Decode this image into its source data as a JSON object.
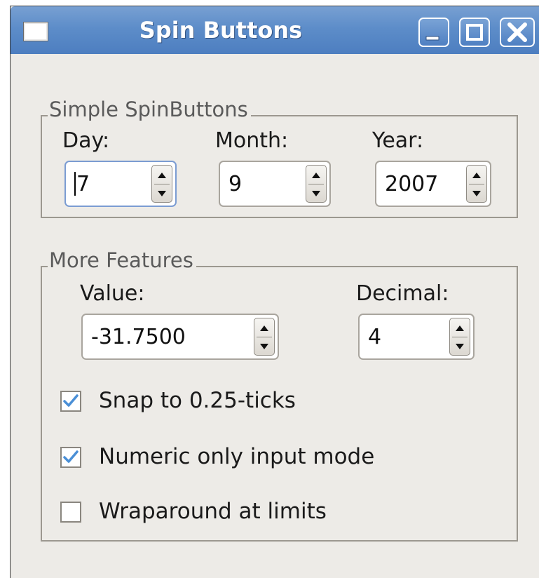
{
  "window": {
    "title": "Spin Buttons",
    "controls": {
      "minimize": "minimize",
      "maximize": "maximize",
      "close": "close"
    }
  },
  "simple": {
    "legend": "Simple SpinButtons",
    "day": {
      "label": "Day:",
      "value": "7"
    },
    "month": {
      "label": "Month:",
      "value": "9"
    },
    "year": {
      "label": "Year:",
      "value": "2007"
    }
  },
  "more": {
    "legend": "More Features",
    "value": {
      "label": "Value:",
      "value": "-31.7500"
    },
    "decimal": {
      "label": "Decimal:",
      "value": "4"
    },
    "options": [
      {
        "label": "Snap to 0.25-ticks",
        "checked": true
      },
      {
        "label": "Numeric only input mode",
        "checked": true
      },
      {
        "label": "Wraparound at limits",
        "checked": false
      }
    ]
  },
  "colors": {
    "titlebar": "#5d8dc9",
    "window_bg": "#edebe7",
    "check_mark": "#4a8fd6"
  }
}
